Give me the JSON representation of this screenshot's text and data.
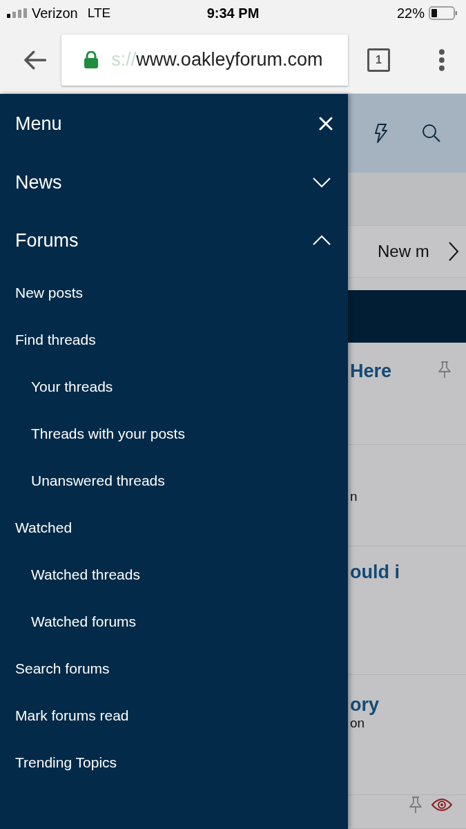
{
  "status_bar": {
    "carrier": "Verizon",
    "network": "LTE",
    "time": "9:34 PM",
    "battery": "22%"
  },
  "browser": {
    "url_faded": "s://",
    "url": "www.oakleyforum.com",
    "tab_count": "1"
  },
  "menu": {
    "title": "Menu",
    "sections": [
      {
        "label": "News",
        "expanded": false
      },
      {
        "label": "Forums",
        "expanded": true,
        "children": [
          {
            "label": "New posts"
          },
          {
            "label": "Find threads",
            "children": [
              {
                "label": "Your threads"
              },
              {
                "label": "Threads with your posts"
              },
              {
                "label": "Unanswered threads"
              }
            ]
          },
          {
            "label": "Watched",
            "children": [
              {
                "label": "Watched threads"
              },
              {
                "label": "Watched forums"
              }
            ]
          },
          {
            "label": "Search forums"
          },
          {
            "label": "Mark forums read"
          },
          {
            "label": "Trending Topics"
          }
        ]
      }
    ]
  },
  "background_page": {
    "nav_tab": "New m",
    "threads": [
      {
        "title": "Here",
        "pinned": true,
        "watched": false
      },
      {
        "subtitle": "n",
        "pinned": false,
        "watched": false
      },
      {
        "title": "ould i",
        "pinned": false,
        "watched": false
      },
      {
        "title": "ory",
        "subtitle": "on",
        "pinned": false,
        "watched": false
      },
      {
        "pinned": true,
        "watched": true
      }
    ]
  }
}
